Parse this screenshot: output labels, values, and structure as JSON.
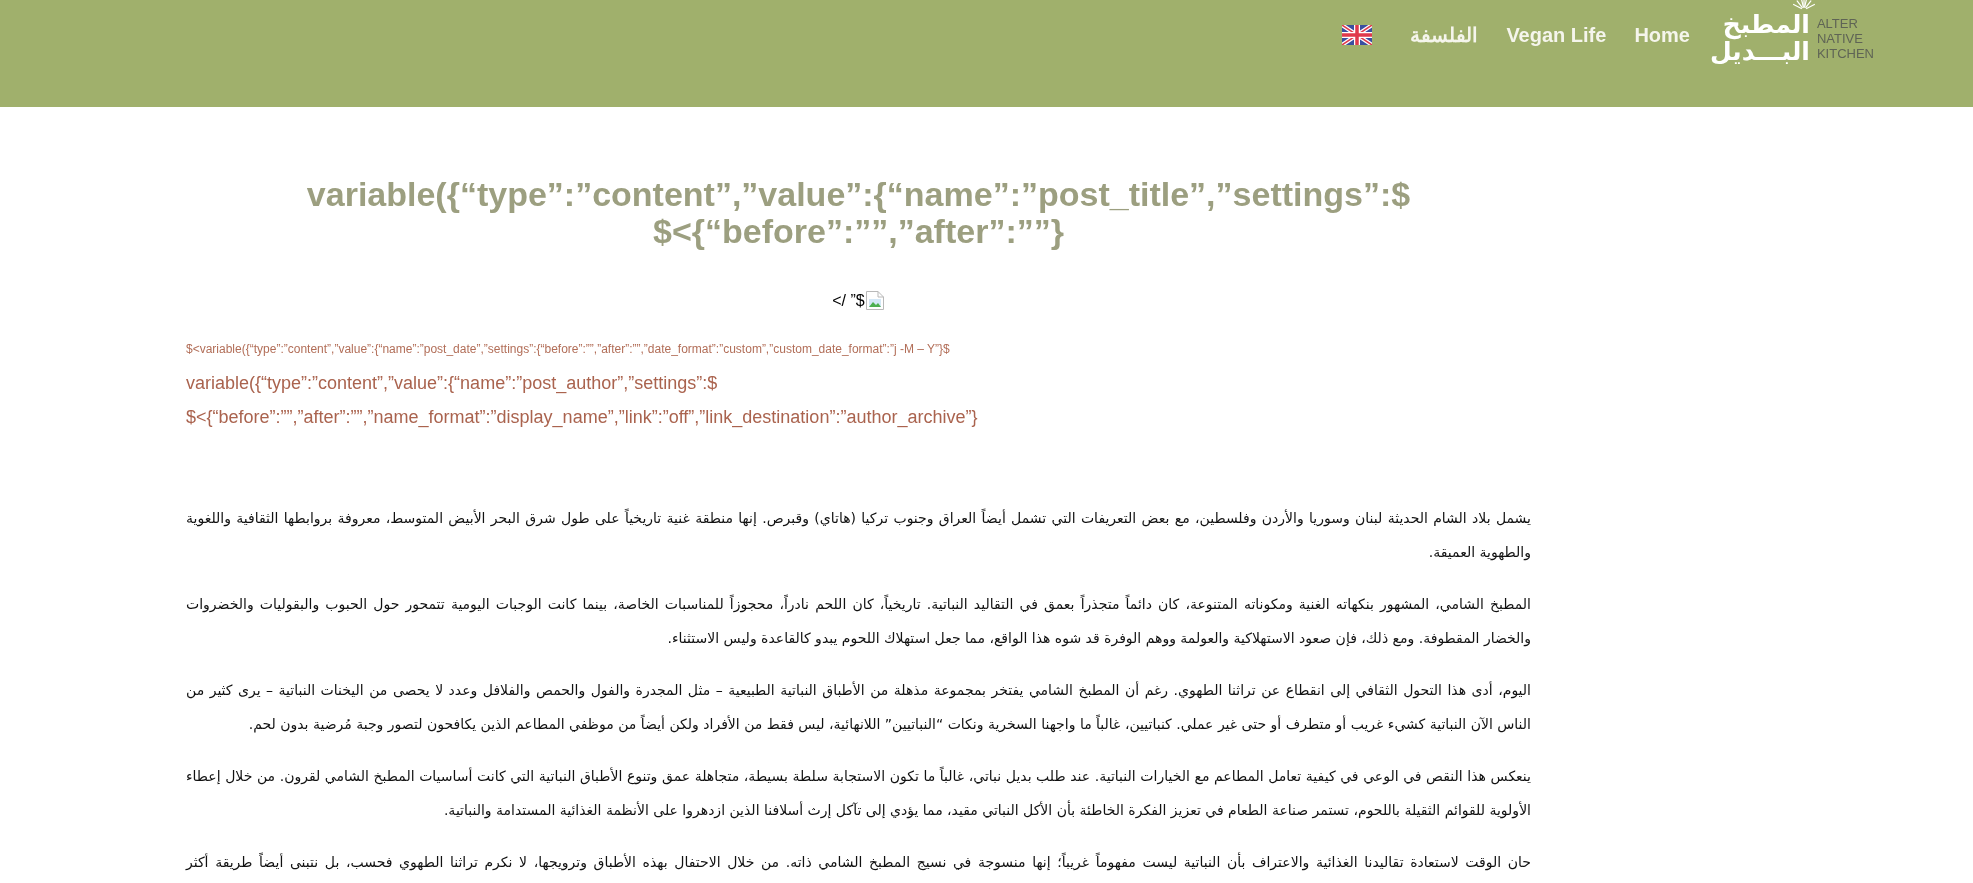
{
  "header": {
    "logo": {
      "arabic_lines": [
        "المطبخ",
        "البـــديل"
      ],
      "english_lines": [
        "ALTER",
        "NATIVE",
        "KITCHEN"
      ]
    },
    "nav": [
      {
        "label": "Home"
      },
      {
        "label": "Vegan Life"
      },
      {
        "label": "الفلسفة"
      }
    ]
  },
  "post": {
    "title": "variable({“type”:”content”,”value”:{“name”:”post_title”,”settings”:$ $<{“before”:””,”after”:””}",
    "image_markup": "</ ”$",
    "date": "$<variable({“type”:”content”,”value”:{“name”:”post_date”,”settings”:{“before”:””,”after”:””,”date_format”:”custom”,”custom_date_format”:”j -M – Y”}$",
    "author": "variable({“type”:”content”,”value”:{“name”:”post_author”,”settings”:$ $<{“before”:””,”after”:””,”name_format”:”display_name”,”link”:”off”,”link_destination”:”author_archive”}",
    "paragraphs": [
      "يشمل بلاد الشام الحديثة لبنان وسوريا والأردن وفلسطين، مع بعض التعريفات التي تشمل أيضاً العراق وجنوب تركيا (هاتاي) وقبرص. إنها منطقة غنية تاريخياً على طول شرق البحر الأبيض المتوسط، معروفة بروابطها الثقافية واللغوية والطهوية العميقة.",
      "المطبخ الشامي، المشهور بنكهاته الغنية ومكوناته المتنوعة، كان دائماً متجذراً بعمق في التقاليد النباتية. تاريخياً، كان اللحم نادراً، محجوزاً للمناسبات الخاصة، بينما كانت الوجبات اليومية تتمحور حول الحبوب والبقوليات والخضروات والخضار المقطوفة. ومع ذلك، فإن صعود الاستهلاكية والعولمة ووهم الوفرة قد شوه هذا الواقع، مما جعل استهلاك اللحوم يبدو كالقاعدة وليس الاستثناء.",
      "اليوم، أدى هذا التحول الثقافي إلى انقطاع عن تراثنا الطهوي. رغم أن المطبخ الشامي يفتخر بمجموعة مذهلة من الأطباق النباتية الطبيعية – مثل المجدرة والفول والحمص والفلافل وعدد لا يحصى من اليخنات النباتية – يرى كثير من الناس الآن النباتية كشيء غريب أو متطرف أو حتى غير عملي. كنباتيين، غالباً ما واجهنا السخرية ونكات “النباتيين” اللانهائية، ليس فقط من الأفراد ولكن أيضاً من موظفي المطاعم الذين يكافحون لتصور وجبة مُرضية بدون لحم.",
      "ينعكس هذا النقص في الوعي في كيفية تعامل المطاعم مع الخيارات النباتية. عند طلب بديل نباتي، غالباً ما تكون الاستجابة سلطة بسيطة، متجاهلة عمق وتنوع الأطباق النباتية التي كانت أساسيات المطبخ الشامي لقرون. من خلال إعطاء الأولوية للقوائم الثقيلة باللحوم، تستمر صناعة الطعام في تعزيز الفكرة الخاطئة بأن الأكل النباتي مقيد، مما يؤدي إلى تآكل إرث أسلافنا الذين ازدهروا على الأنظمة الغذائية المستدامة والنباتية.",
      "حان الوقت لاستعادة تقاليدنا الغذائية والاعتراف بأن النباتية ليست مفهوماً غريباً؛ إنها منسوجة في نسيج المطبخ الشامي ذاته. من خلال الاحتفال بهذه الأطباق وترويجها، لا نكرم تراثنا الطهوي فحسب، بل نتبنى أيضاً طريقة أكثر"
    ]
  }
}
